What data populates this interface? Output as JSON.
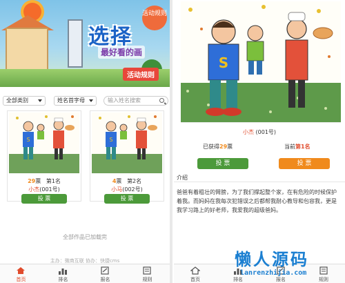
{
  "colors": {
    "accent": "#e04b2c",
    "vote_green": "#4c9a3a",
    "orange": "#f08a1c",
    "title_blue": "#1b63c6"
  },
  "left": {
    "banner": {
      "title": "选择",
      "subtitle": "最好看的画",
      "tag": "活动规则"
    },
    "rules_badge": "活动规则",
    "filters": {
      "category": "全部类别",
      "letter": "姓名首字母",
      "search_placeholder": "输入姓名搜索"
    },
    "cards": [
      {
        "votes": "29",
        "votes_suffix": "票",
        "rank": "第1名",
        "name": "小杰",
        "number": "(001号)",
        "button": "投 票"
      },
      {
        "votes": "4",
        "votes_suffix": "票",
        "rank": "第2名",
        "name": "小马",
        "number": "(002号)",
        "button": "投 票"
      }
    ],
    "all_loaded": "全部作品已加载完",
    "credit": "主办：微商互联  协办：快捷cms",
    "tabs": [
      {
        "label": "首页",
        "icon": "home-icon"
      },
      {
        "label": "排名",
        "icon": "bar-chart-icon"
      },
      {
        "label": "报名",
        "icon": "edit-icon"
      },
      {
        "label": "规则",
        "icon": "rules-icon"
      }
    ]
  },
  "right": {
    "name": "小杰",
    "number": "(001号)",
    "votes_prefix": "已获得",
    "votes": "29",
    "votes_suffix": "票",
    "rank_prefix": "当前",
    "rank": "第1名",
    "vote_button": "投 票",
    "share_button": "投 票",
    "intro_heading": "介绍",
    "intro_text": "爸爸有着粗壮的臂膀，为了我们撑起整个家，在有危险的时候保护着我。而妈妈在我每次犯错误之后都帮我耐心教导和包容我，更是我学习路上的好老师，我爱我的超级爸妈。",
    "tabs": [
      {
        "label": "首页",
        "icon": "home-icon"
      },
      {
        "label": "排名",
        "icon": "bar-chart-icon"
      },
      {
        "label": "报名",
        "icon": "edit-icon"
      },
      {
        "label": "规则",
        "icon": "rules-icon"
      }
    ]
  },
  "watermark": {
    "text": "懒人源码",
    "url": "lanrenzhijia.com"
  }
}
